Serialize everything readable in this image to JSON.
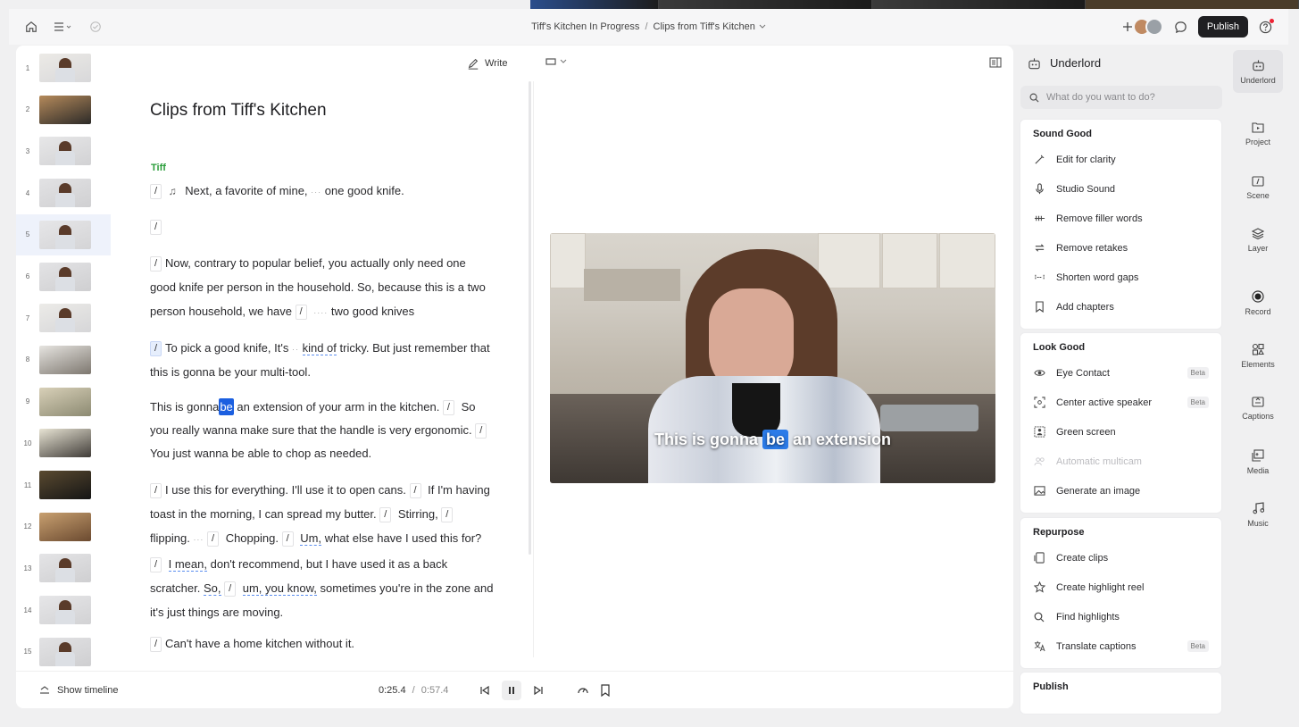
{
  "header": {
    "breadcrumb_project": "Tiff's Kitchen In Progress",
    "breadcrumb_sep": "/",
    "breadcrumb_doc": "Clips from Tiff's Kitchen",
    "publish_label": "Publish"
  },
  "editor": {
    "write_label": "Write",
    "title": "Clips from Tiff's Kitchen",
    "speaker": "Tiff",
    "p1": {
      "text1": "Next, a favorite of mine,",
      "gap": "···",
      "text2": "one good knife."
    },
    "p3": {
      "line": "Now, contrary to popular belief, you actually only need one good knife per person in the household. So, because this is a two person household, we have",
      "gap": "····",
      "tail": "two good knives"
    },
    "p4": {
      "a": "To pick a good knife, It's",
      "gap": "··",
      "ul": "kind of",
      "b": "tricky. But just remember that this is gonna be your multi-tool."
    },
    "p5": {
      "a": "This is gonna",
      "sel": "be",
      "b": "an extension of your arm in the kitchen.",
      "c": "So you really wanna make sure that the handle is very ergonomic.",
      "d": "You just wanna be able to chop as needed."
    },
    "p6": {
      "a": "I use this for everything.",
      "b": "I'll use it to open cans.",
      "c": "If I'm having toast in the morning, I can spread my butter.",
      "d": "Stirring,",
      "e": "flipping.",
      "gap": "···",
      "f": "Chopping.",
      "g_ul": "Um,",
      "g": "what else have I used this for?",
      "h_ul": "I mean,",
      "h": "don't recommend, but I have used it as a back scratcher.",
      "i_ul": "So,",
      "j_ul": "um, you know,",
      "j": "sometimes you're in the zone and it's just things are moving."
    },
    "p7": {
      "text": "Can't have a home kitchen without it."
    },
    "slash": "/"
  },
  "thumbnails": [
    "1",
    "2",
    "3",
    "4",
    "5",
    "6",
    "7",
    "8",
    "9",
    "10",
    "11",
    "12",
    "13",
    "14",
    "15"
  ],
  "active_thumb": 5,
  "video": {
    "caption_pre": "This is gonna",
    "caption_hl": "be",
    "caption_post": "an extension"
  },
  "bottom": {
    "show_timeline": "Show timeline",
    "current_time": "0:25.4",
    "sep": "/",
    "total_time": "0:57.4"
  },
  "underlord": {
    "title": "Underlord",
    "search_placeholder": "What do you want to do?",
    "sound_good": {
      "title": "Sound Good",
      "items": [
        "Edit for clarity",
        "Studio Sound",
        "Remove filler words",
        "Remove retakes",
        "Shorten word gaps",
        "Add chapters"
      ]
    },
    "look_good": {
      "title": "Look Good",
      "items": [
        "Eye Contact",
        "Center active speaker",
        "Green screen",
        "Automatic multicam",
        "Generate an image"
      ],
      "beta": "Beta"
    },
    "repurpose": {
      "title": "Repurpose",
      "items": [
        "Create clips",
        "Create highlight reel",
        "Find highlights",
        "Translate captions"
      ]
    },
    "publish": {
      "title": "Publish"
    }
  },
  "rail": [
    "Underlord",
    "Project",
    "Scene",
    "Layer",
    "Record",
    "Elements",
    "Captions",
    "Media",
    "Music"
  ],
  "colors": {
    "accent": "#1b5fe0",
    "speaker": "#2a9d3a",
    "publish_bg": "#1f1f22"
  }
}
